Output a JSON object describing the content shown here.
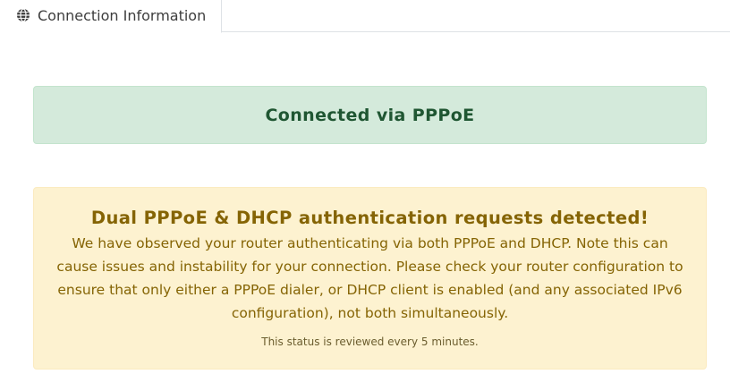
{
  "tabs": [
    {
      "label": "Connection Information",
      "icon": "globe-icon",
      "active": true
    }
  ],
  "status": {
    "title": "Connected via PPPoE",
    "color": "#1f5632",
    "background": "#d4eadb"
  },
  "warning": {
    "title": "Dual PPPoE & DHCP authentication requests detected!",
    "body": "We have observed your router authenticating via both PPPoE and DHCP. Note this can cause issues and instability for your connection. Please check your router configuration to ensure that only either a PPPoE dialer, or DHCP client is enabled (and any associated IPv6 configuration), not both simultaneously.",
    "note": "This status is reviewed every 5 minutes.",
    "color": "#856404",
    "background": "#fdf2d0"
  }
}
